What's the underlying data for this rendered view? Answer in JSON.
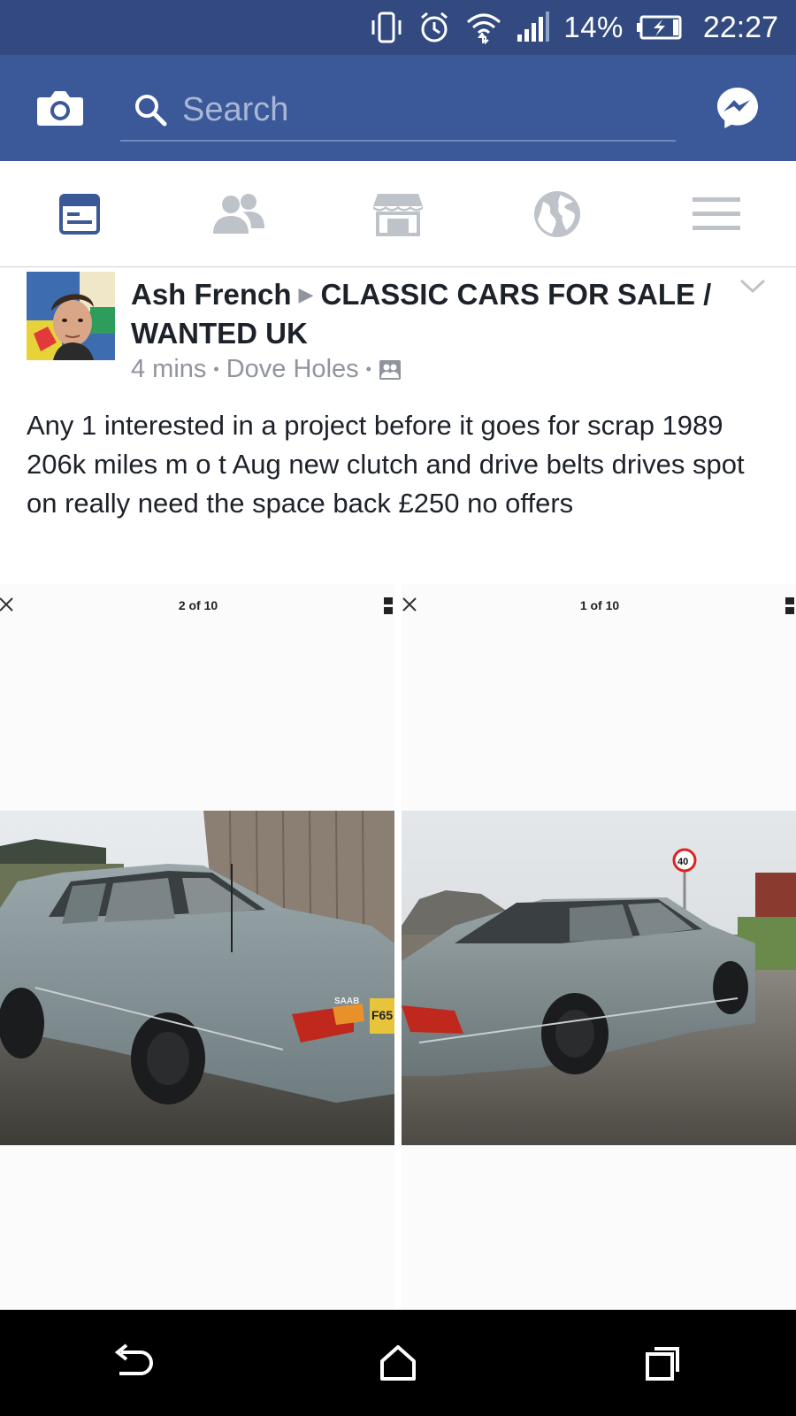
{
  "status_bar": {
    "battery_percent": "14%",
    "time": "22:27",
    "icons": [
      "vibrate-icon",
      "alarm-icon",
      "wifi-icon",
      "signal-icon",
      "battery-charging-icon"
    ]
  },
  "header": {
    "search_placeholder": "Search",
    "camera_icon": "camera-icon",
    "messenger_icon": "messenger-icon"
  },
  "nav_tabs": [
    {
      "icon": "news-feed-icon",
      "active": true
    },
    {
      "icon": "friends-icon",
      "active": false
    },
    {
      "icon": "marketplace-icon",
      "active": false
    },
    {
      "icon": "notifications-globe-icon",
      "active": false
    },
    {
      "icon": "menu-icon",
      "active": false
    }
  ],
  "post": {
    "author": "Ash French",
    "group": "CLASSIC CARS FOR SALE / WANTED UK",
    "time": "4 mins",
    "location": "Dove Holes",
    "text": "Any 1 interested in a project before it goes for scrap 1989 206k miles m o t Aug  new clutch and drive belts drives spot on really need the space back £250 no offers",
    "photos": [
      {
        "counter": "2 of 10",
        "plate_text": "F65",
        "badge_text": "SAAB"
      },
      {
        "counter": "1 of 10",
        "sign_text": "40"
      }
    ]
  },
  "colors": {
    "status_bar": "#324a7f",
    "header": "#3b5998",
    "active_tab": "#3b5998",
    "inactive_tab": "#bec3c9"
  }
}
